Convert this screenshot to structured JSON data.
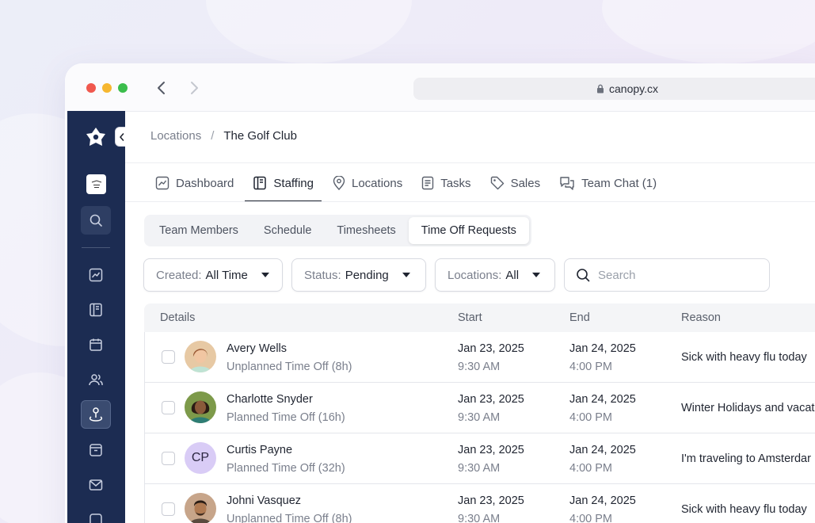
{
  "browser": {
    "url": "canopy.cx"
  },
  "breadcrumb": {
    "parent": "Locations",
    "separator": "/",
    "current": "The Golf Club"
  },
  "tabs": [
    {
      "label": "Dashboard",
      "icon": "chart-icon"
    },
    {
      "label": "Staffing",
      "icon": "staffing-icon"
    },
    {
      "label": "Locations",
      "icon": "map-pin-icon"
    },
    {
      "label": "Tasks",
      "icon": "document-icon"
    },
    {
      "label": "Sales",
      "icon": "tag-icon"
    },
    {
      "label": "Team Chat (1)",
      "icon": "chat-icon"
    }
  ],
  "active_tab": "Staffing",
  "subtabs": [
    {
      "label": "Team Members"
    },
    {
      "label": "Schedule"
    },
    {
      "label": "Timesheets"
    },
    {
      "label": "Time Off Requests"
    }
  ],
  "active_subtab": "Time Off Requests",
  "filters": {
    "created": {
      "label": "Created:",
      "value": "All Time"
    },
    "status": {
      "label": "Status:",
      "value": "Pending"
    },
    "locations": {
      "label": "Locations:",
      "value": "All"
    },
    "search_placeholder": "Search"
  },
  "table": {
    "headers": {
      "details": "Details",
      "start": "Start",
      "end": "End",
      "reason": "Reason"
    },
    "rows": [
      {
        "name": "Avery Wells",
        "type": "Unplanned Time Off (8h)",
        "start_date": "Jan 23, 2025",
        "start_time": "9:30 AM",
        "end_date": "Jan 24, 2025",
        "end_time": "4:00 PM",
        "reason": "Sick with heavy flu today"
      },
      {
        "name": "Charlotte Snyder",
        "type": "Planned Time Off (16h)",
        "start_date": "Jan 23, 2025",
        "start_time": "9:30 AM",
        "end_date": "Jan 24, 2025",
        "end_time": "4:00 PM",
        "reason": "Winter Holidays and vacat"
      },
      {
        "name": "Curtis Payne",
        "initials": "CP",
        "type": "Planned Time Off (32h)",
        "start_date": "Jan 23, 2025",
        "start_time": "9:30 AM",
        "end_date": "Jan 24, 2025",
        "end_time": "4:00 PM",
        "reason": "I'm traveling to Amsterdar"
      },
      {
        "name": "Johni Vasquez",
        "type": "Unplanned Time Off (8h)",
        "start_date": "Jan 23, 2025",
        "start_time": "9:30 AM",
        "end_date": "Jan 24, 2025",
        "end_time": "4:00 PM",
        "reason": "Sick with heavy flu today"
      }
    ]
  },
  "colors": {
    "sidebar": "#1c2c52",
    "accent_text": "#1f2430",
    "muted_text": "#7a7f8c",
    "traffic_red": "#f0584e",
    "traffic_yellow": "#f6b730",
    "traffic_green": "#3bbd4c"
  }
}
